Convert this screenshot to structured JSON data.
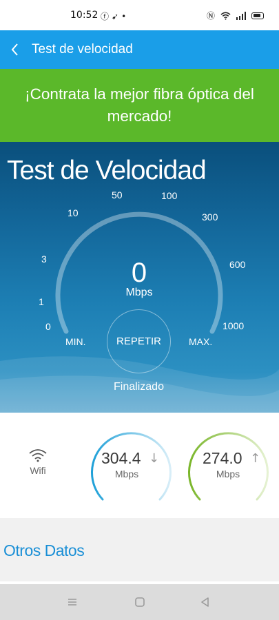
{
  "status_bar": {
    "time": "10:52",
    "left_icons": [
      "facebook-icon",
      "bird-icon",
      "dot-icon"
    ],
    "right_icons": [
      "nfc-icon",
      "wifi-icon",
      "signal-icon",
      "battery-icon"
    ]
  },
  "app_bar": {
    "title": "Test de velocidad",
    "back_icon": "back-chevron-icon",
    "color": "#1a9ee8"
  },
  "promo": {
    "text": "¡Contrata la mejor fibra óptica del mercado!",
    "color": "#5bb82a"
  },
  "speed_test": {
    "title": "Test de Velocidad",
    "scale_ticks": [
      "0",
      "1",
      "3",
      "10",
      "50",
      "100",
      "300",
      "600",
      "1000"
    ],
    "value": "0",
    "unit": "Mbps",
    "min_label": "MIN.",
    "max_label": "MAX.",
    "repeat_label": "REPETIR",
    "status": "Finalizado"
  },
  "results": {
    "connection": "Wifi",
    "download": {
      "value": "304.4",
      "unit": "Mbps",
      "arrow": "↓",
      "color": "#1ea0d8"
    },
    "upload": {
      "value": "274.0",
      "unit": "Mbps",
      "arrow": "↑",
      "color": "#7ab62a"
    }
  },
  "other_data": {
    "title": "Otros Datos"
  },
  "nav_bar": {
    "buttons": [
      "menu-icon",
      "home-icon",
      "back-icon"
    ]
  }
}
